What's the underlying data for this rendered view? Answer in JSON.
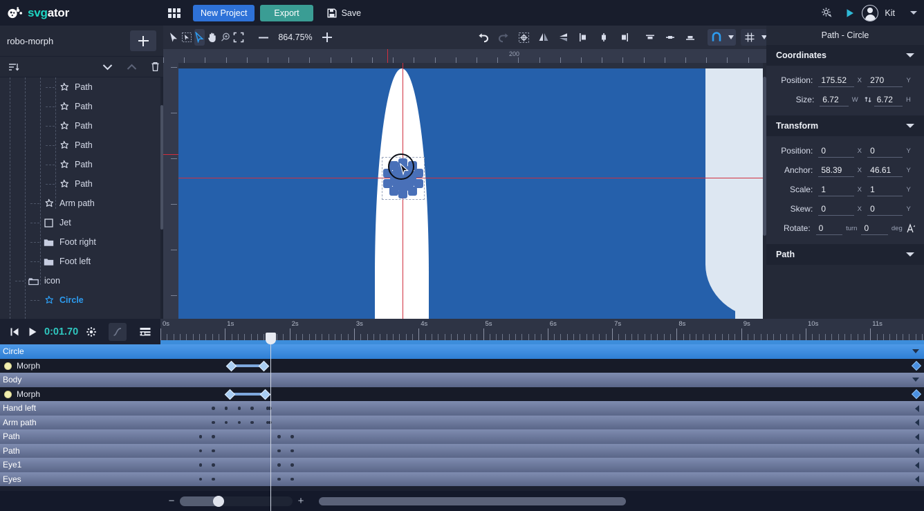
{
  "app": {
    "brand_svg": "svg",
    "brand_ator": "ator",
    "logo_icon": "svgator-logo-icon"
  },
  "header": {
    "apps_icon": "apps-grid-icon",
    "new_project_label": "New Project",
    "export_label": "Export",
    "save_label": "Save",
    "save_icon": "floppy-disk-icon",
    "settings_icon": "settings-gear-icon",
    "preview_icon": "play-preview-icon",
    "user_name": "Kit",
    "avatar_icon": "user-avatar-icon",
    "account_caret_icon": "chevron-down-icon",
    "accent_new": "#2e72d8",
    "accent_export": "#3a9d94",
    "accent_brand": "#1fd6c3"
  },
  "left_panel": {
    "project_name": "robo-morph",
    "add_icon": "plus-icon",
    "sort_icon": "sort-layers-icon",
    "collapse_down_icon": "chevron-down-icon",
    "collapse_up_icon": "chevron-up-icon",
    "delete_icon": "trash-icon",
    "layers": [
      {
        "label": "Path",
        "icon": "path-star-icon",
        "depth": 3,
        "selected": false
      },
      {
        "label": "Path",
        "icon": "path-star-icon",
        "depth": 3,
        "selected": false
      },
      {
        "label": "Path",
        "icon": "path-star-icon",
        "depth": 3,
        "selected": false
      },
      {
        "label": "Path",
        "icon": "path-star-icon",
        "depth": 3,
        "selected": false
      },
      {
        "label": "Path",
        "icon": "path-star-icon",
        "depth": 3,
        "selected": false
      },
      {
        "label": "Path",
        "icon": "path-star-icon",
        "depth": 3,
        "selected": false
      },
      {
        "label": "Arm path",
        "icon": "path-star-icon",
        "depth": 2,
        "selected": false
      },
      {
        "label": "Jet",
        "icon": "rect-shape-icon",
        "depth": 2,
        "selected": false
      },
      {
        "label": "Foot right",
        "icon": "folder-icon",
        "depth": 2,
        "selected": false
      },
      {
        "label": "Foot left",
        "icon": "folder-icon",
        "depth": 2,
        "selected": false
      },
      {
        "label": "icon",
        "icon": "folder-open-icon",
        "depth": 1,
        "selected": false
      },
      {
        "label": "Circle",
        "icon": "path-star-icon",
        "depth": 2,
        "selected": true
      }
    ]
  },
  "canvas": {
    "tools": [
      {
        "name": "select-tool",
        "icon": "arrow-cursor-icon",
        "active": false
      },
      {
        "name": "transform-tool",
        "icon": "free-transform-icon",
        "active": false
      },
      {
        "name": "node-tool",
        "icon": "node-edit-icon",
        "active": true
      },
      {
        "name": "pan-tool",
        "icon": "hand-icon",
        "active": false
      },
      {
        "name": "zoom-tool",
        "icon": "magnifier-icon",
        "active": false
      },
      {
        "name": "fit-tool",
        "icon": "fit-to-screen-icon",
        "active": false
      }
    ],
    "zoom_out_icon": "minus-icon",
    "zoom_level": "864.75%",
    "zoom_in_icon": "plus-icon",
    "undo_icon": "undo-arrow-icon",
    "redo_icon": "redo-arrow-icon",
    "align_tools": [
      {
        "name": "align-center-target",
        "icon": "align-target-icon"
      },
      {
        "name": "flip-horizontal",
        "icon": "flip-horizontal-icon"
      },
      {
        "name": "flip-vertical",
        "icon": "flip-vertical-icon"
      },
      {
        "name": "align-left",
        "icon": "align-left-icon"
      },
      {
        "name": "align-center-h",
        "icon": "align-center-h-icon"
      },
      {
        "name": "align-right",
        "icon": "align-right-icon"
      },
      {
        "name": "align-top",
        "icon": "align-top-icon"
      },
      {
        "name": "align-middle-v",
        "icon": "align-middle-v-icon"
      },
      {
        "name": "align-bottom",
        "icon": "align-bottom-icon"
      }
    ],
    "snap_icon": "magnet-icon",
    "snap_caret_icon": "chevron-down-icon",
    "grid_icon": "grid-icon",
    "grid_caret_icon": "chevron-down-icon",
    "ruler_icon": "rulers-icon",
    "ruler_caret_icon": "chevron-down-icon",
    "ruler_labels": [
      "200"
    ],
    "artwork_colors": {
      "blue_bg": "#2560ab",
      "white_body": "#ffffff",
      "light_blue": "#dde7f2",
      "gear_fill": "#4970b8",
      "guide_red": "#d12f3e"
    }
  },
  "right_panel": {
    "title": "Path - Circle",
    "sections": [
      {
        "name": "Coordinates",
        "caret": "chevron-down-icon"
      },
      {
        "name": "Transform",
        "caret": "chevron-down-icon"
      },
      {
        "name": "Path",
        "caret": "chevron-down-icon"
      }
    ],
    "coordinates": {
      "position_label": "Position:",
      "position_x": "175.52",
      "position_x_unit": "X",
      "position_y": "270",
      "position_y_unit": "Y",
      "size_label": "Size:",
      "size_w": "6.72",
      "size_w_unit": "W",
      "size_h": "6.72",
      "size_h_unit": "H",
      "link_icon": "link-ratio-icon"
    },
    "transform": {
      "rows": [
        {
          "label": "Position:",
          "x": "0",
          "xu": "X",
          "y": "0",
          "yu": "Y"
        },
        {
          "label": "Anchor:",
          "x": "58.39",
          "xu": "X",
          "y": "46.61",
          "yu": "Y"
        },
        {
          "label": "Scale:",
          "x": "1",
          "xu": "X",
          "y": "1",
          "yu": "Y"
        },
        {
          "label": "Skew:",
          "x": "0",
          "xu": "X",
          "y": "0",
          "yu": "Y"
        },
        {
          "label": "Rotate:",
          "x": "0",
          "xu": "turn",
          "y": "0",
          "yu": "deg"
        }
      ],
      "rotate_tool_icon": "rotate-anchor-icon"
    }
  },
  "timeline": {
    "go_start_icon": "skip-to-start-icon",
    "play_icon": "play-icon",
    "current_time": "0:01.70",
    "settings_icon": "gear-icon",
    "easing_icon": "easing-curve-icon",
    "options_icon": "timeline-options-icon",
    "ruler_labels": [
      "0s",
      "1s",
      "2s",
      "3s",
      "4s",
      "5s",
      "6s",
      "7s",
      "8s",
      "9s",
      "10s",
      "11s"
    ],
    "playhead_time_s": 1.7,
    "rows": [
      {
        "label": "Circle",
        "type": "group",
        "selected": true,
        "indicator": "caret-down",
        "keyframes": [],
        "dots": []
      },
      {
        "label": "Morph",
        "type": "prop",
        "selected": false,
        "indicator": "diamond",
        "keyframes": [
          1.1,
          1.6
        ],
        "dots": []
      },
      {
        "label": "Body",
        "type": "group",
        "selected": false,
        "indicator": "caret-down",
        "keyframes": [],
        "dots": []
      },
      {
        "label": "Morph",
        "type": "prop",
        "selected": false,
        "indicator": "diamond",
        "keyframes": [
          1.08,
          1.62
        ],
        "dots": []
      },
      {
        "label": "Hand left",
        "type": "group",
        "selected": false,
        "indicator": "caret-left",
        "keyframes": [],
        "dots": [
          0.82,
          1.02,
          1.22,
          1.42,
          1.66,
          1.7
        ]
      },
      {
        "label": "Arm path",
        "type": "group",
        "selected": false,
        "indicator": "caret-left",
        "keyframes": [],
        "dots": [
          0.82,
          1.02,
          1.22,
          1.42,
          1.66,
          1.7
        ]
      },
      {
        "label": "Path",
        "type": "group",
        "selected": false,
        "indicator": "caret-left",
        "keyframes": [],
        "dots": [
          0.62,
          0.82,
          1.84,
          2.04
        ]
      },
      {
        "label": "Path",
        "type": "group",
        "selected": false,
        "indicator": "caret-left",
        "keyframes": [],
        "dots": [
          0.62,
          0.82,
          1.84,
          2.04
        ]
      },
      {
        "label": "Eye1",
        "type": "group",
        "selected": false,
        "indicator": "caret-left",
        "keyframes": [],
        "dots": [
          0.62,
          0.82,
          1.84,
          2.04
        ]
      },
      {
        "label": "Eyes",
        "type": "group",
        "selected": false,
        "indicator": "caret-left",
        "keyframes": [],
        "dots": [
          0.62,
          0.82,
          1.84,
          2.04
        ]
      }
    ],
    "zoom_minus": "−",
    "zoom_plus": "+",
    "zoom_slider_value": 30
  }
}
